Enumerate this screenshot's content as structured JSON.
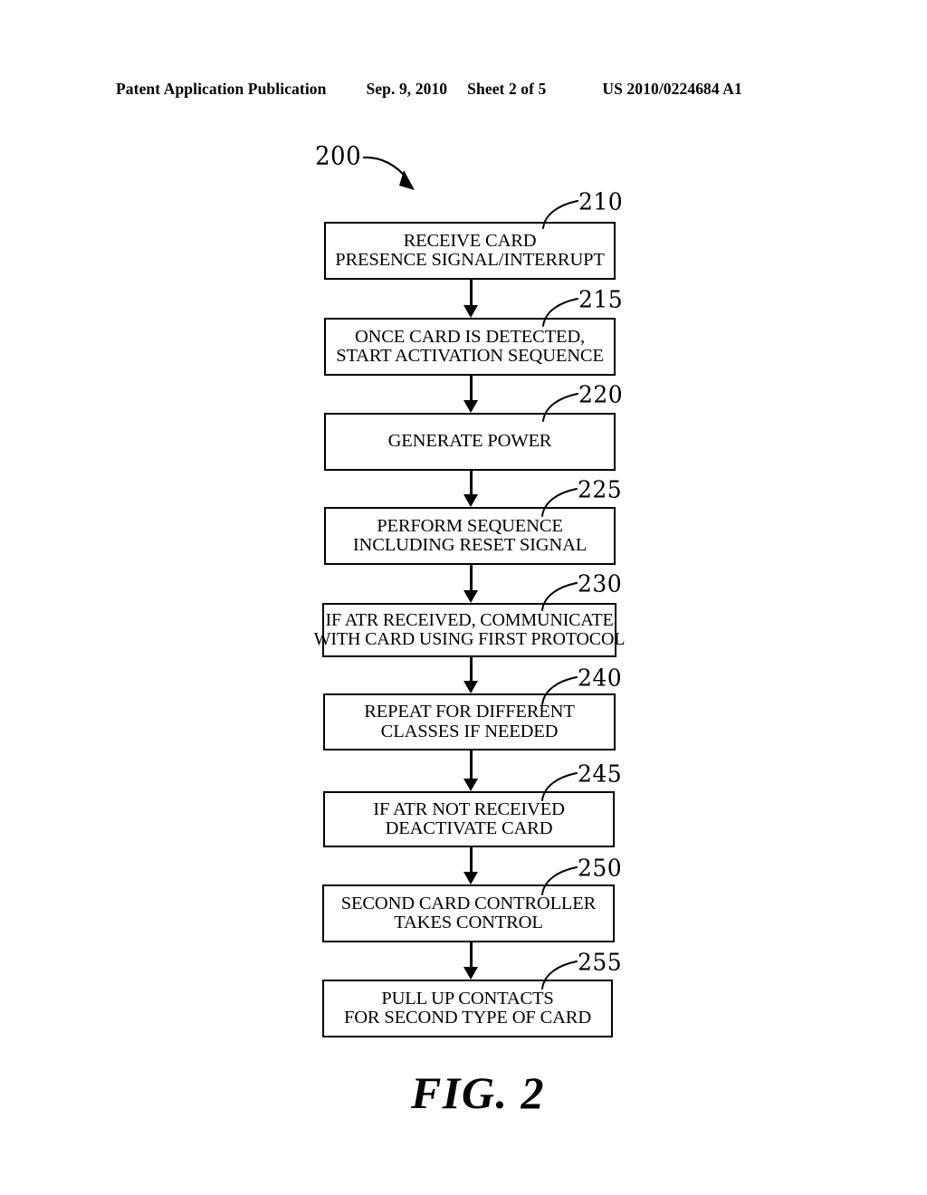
{
  "header": {
    "publication": "Patent Application Publication",
    "date": "Sep. 9, 2010",
    "sheet": "Sheet 2 of 5",
    "patent_number": "US 2010/0224684 A1"
  },
  "figure": {
    "caption": "FIG. 2",
    "diagram_label": "200",
    "colors": {
      "ink": "#000000",
      "page": "#ffffff"
    },
    "steps": [
      {
        "ref": "210",
        "lines": [
          "RECEIVE CARD",
          "PRESENCE SIGNAL/INTERRUPT"
        ]
      },
      {
        "ref": "215",
        "lines": [
          "ONCE CARD IS DETECTED,",
          "START ACTIVATION SEQUENCE"
        ]
      },
      {
        "ref": "220",
        "lines": [
          "GENERATE POWER"
        ]
      },
      {
        "ref": "225",
        "lines": [
          "PERFORM SEQUENCE",
          "INCLUDING RESET SIGNAL"
        ]
      },
      {
        "ref": "230",
        "lines": [
          "IF ATR RECEIVED, COMMUNICATE",
          "WITH CARD USING FIRST PROTOCOL"
        ]
      },
      {
        "ref": "240",
        "lines": [
          "REPEAT FOR DIFFERENT",
          "CLASSES IF NEEDED"
        ]
      },
      {
        "ref": "245",
        "lines": [
          "IF ATR NOT RECEIVED",
          "DEACTIVATE CARD"
        ]
      },
      {
        "ref": "250",
        "lines": [
          "SECOND CARD CONTROLLER",
          "TAKES CONTROL"
        ]
      },
      {
        "ref": "255",
        "lines": [
          "PULL UP CONTACTS",
          "FOR SECOND TYPE OF CARD"
        ]
      }
    ]
  }
}
